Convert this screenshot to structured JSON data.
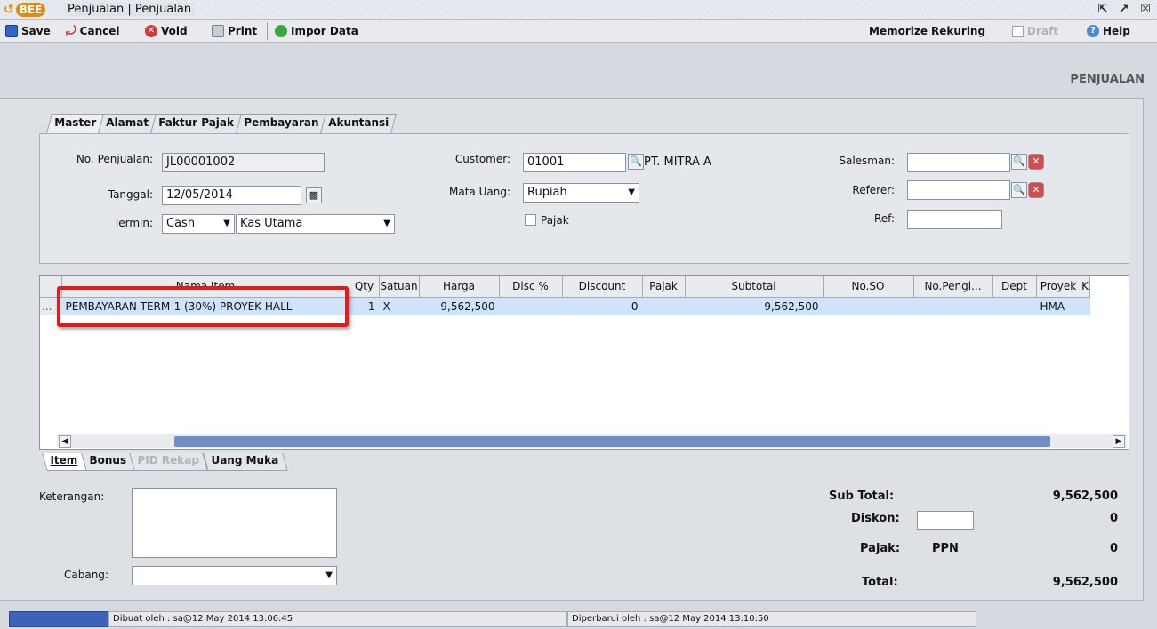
{
  "window": {
    "logo_mark": "BEE",
    "title": "Penjualan | Penjualan",
    "controls": [
      "restore",
      "maximize",
      "close"
    ]
  },
  "toolbar": {
    "save": "Save",
    "cancel": "Cancel",
    "void": "Void",
    "print": "Print",
    "impor": "Impor Data",
    "memorize": "Memorize",
    "rekuring": "Rekuring",
    "draft": "Draft",
    "help": "Help"
  },
  "page_label": "PENJUALAN",
  "tabs_top": [
    "Master",
    "Alamat",
    "Faktur Pajak",
    "Pembayaran",
    "Akuntansi"
  ],
  "form": {
    "no_penjualan_label": "No. Penjualan:",
    "no_penjualan": "JL00001002",
    "tanggal_label": "Tanggal:",
    "tanggal": "12/05/2014",
    "termin_label": "Termin:",
    "termin": "Cash",
    "kas": "Kas Utama",
    "customer_label": "Customer:",
    "customer_code": "01001",
    "customer_name": "PT. MITRA A",
    "mata_uang_label": "Mata Uang:",
    "mata_uang": "Rupiah",
    "pajak_label": "Pajak",
    "salesman_label": "Salesman:",
    "referer_label": "Referer:",
    "ref_label": "Ref:"
  },
  "grid": {
    "columns": [
      "Nama Item",
      "Qty",
      "Satuan",
      "Harga",
      "Disc %",
      "Discount",
      "Pajak",
      "Subtotal",
      "No.SO",
      "No.Pengi...",
      "Dept",
      "Proyek",
      "K"
    ],
    "rows": [
      {
        "marker": "...",
        "nama_item": "PEMBAYARAN TERM-1 (30%) PROYEK HALL",
        "qty": "1",
        "satuan": "X",
        "harga": "9,562,500",
        "disc_pct": "",
        "discount": "0",
        "pajak": "",
        "subtotal": "9,562,500",
        "no_so": "",
        "no_pengiriman": "",
        "dept": "",
        "proyek": "HMA"
      }
    ]
  },
  "tabs_bottom": [
    "Item",
    "Bonus",
    "PID Rekap",
    "Uang Muka"
  ],
  "keterangan_label": "Keterangan:",
  "cabang_label": "Cabang:",
  "totals": {
    "sub_total_label": "Sub Total:",
    "sub_total": "9,562,500",
    "diskon_label": "Diskon:",
    "diskon": "0",
    "pajak_label": "Pajak:",
    "pajak_name": "PPN",
    "pajak": "0",
    "total_label": "Total:",
    "total": "9,562,500"
  },
  "status": {
    "dibuat": "Dibuat oleh : sa@12 May 2014  13:06:45",
    "diperbarui": "Diperbarui oleh : sa@12 May 2014  13:10:50"
  }
}
